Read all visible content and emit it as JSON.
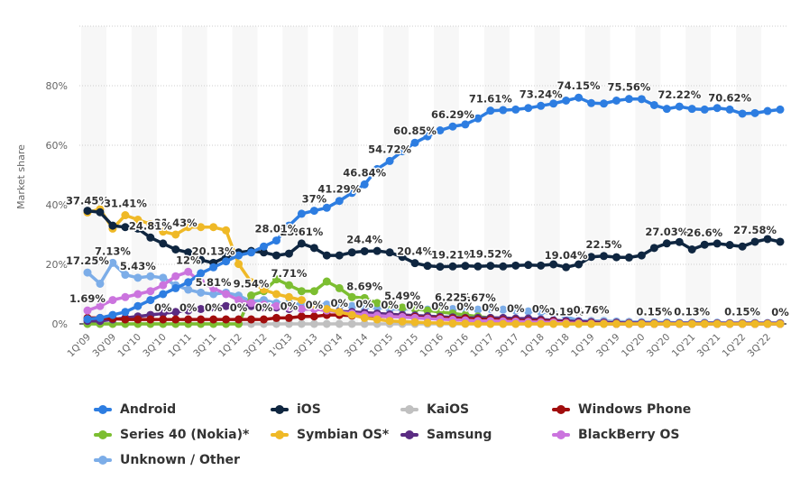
{
  "chart_data": {
    "type": "line",
    "title": "",
    "xlabel": "",
    "ylabel": "Market share",
    "ylim": [
      0,
      100
    ],
    "yticks": [
      "0%",
      "20%",
      "40%",
      "60%",
      "80%"
    ],
    "ytick_values": [
      0,
      20,
      40,
      60,
      80
    ],
    "grid": true,
    "legend_position": "bottom",
    "categories": [
      "1Q'09",
      "2Q'09",
      "3Q'09",
      "4Q'09",
      "1Q'10",
      "2Q'10",
      "3Q'10",
      "4Q'10",
      "1Q'11",
      "2Q'11",
      "3Q'11",
      "4Q'11",
      "1Q'12",
      "2Q'12",
      "3Q'12",
      "4Q'12",
      "1Q'13",
      "2Q'13",
      "3Q'13",
      "4Q'13",
      "1Q'14",
      "2Q'14",
      "3Q'14",
      "4Q'14",
      "1Q'15",
      "2Q'15",
      "3Q'15",
      "4Q'15",
      "1Q'16",
      "2Q'16",
      "3Q'16",
      "4Q'16",
      "1Q'17",
      "2Q'17",
      "3Q'17",
      "4Q'17",
      "1Q'18",
      "2Q'18",
      "3Q'18",
      "4Q'18",
      "1Q'19",
      "2Q'19",
      "3Q'19",
      "4Q'19",
      "1Q'20",
      "2Q'20",
      "3Q'20",
      "4Q'20",
      "1Q'21",
      "2Q'21",
      "3Q'21",
      "4Q'21",
      "1Q'22",
      "2Q'22",
      "3Q'22",
      "4Q'22"
    ],
    "xtick_labels": [
      "1Q'09",
      "3Q'09",
      "1Q'10",
      "3Q'10",
      "1Q'11",
      "3Q'11",
      "1Q'12",
      "3Q'12",
      "1'Q13",
      "3Q'13",
      "1Q'14",
      "3Q'14",
      "1Q'15",
      "3Q'15",
      "1Q'16",
      "3Q'16",
      "1Q'17",
      "3Q'17",
      "1Q'18",
      "3Q'18",
      "1Q'19",
      "3Q'19",
      "1Q'20",
      "3Q'20",
      "1Q'21",
      "3Q'21",
      "1Q'22",
      "3Q'22"
    ],
    "series": [
      {
        "name": "Unknown / Other",
        "color": "#7cade8",
        "values": [
          17.25,
          13.5,
          20.5,
          16.5,
          15.5,
          16,
          15.5,
          13,
          11.5,
          10.5,
          10,
          10.5,
          9.5,
          7.5,
          8,
          7,
          7,
          6.5,
          6.5,
          6.5,
          6,
          6,
          5.5,
          5.5,
          5,
          5,
          5,
          4.8,
          5.5,
          5,
          5,
          4.8,
          5,
          4.8,
          4.5,
          4.2,
          4,
          3.5,
          2.5,
          1,
          1,
          1,
          0.8,
          0.7,
          0.6,
          0.5,
          0.5,
          0.4,
          0.4,
          0.4,
          0.4,
          0.3,
          0.3,
          0.3,
          0.3,
          0.3
        ],
        "labels": {
          "0": "17.25%",
          "2": "7.13%",
          "4": "5.43%",
          "10": "5.81%",
          "29": "6.22%",
          "31": "5.67%"
        }
      },
      {
        "name": "KaiOS",
        "color": "#c0c0c0",
        "values": [
          0,
          0,
          0,
          0,
          0,
          0,
          0,
          0,
          0,
          0,
          0,
          0,
          0,
          0,
          0,
          0,
          0,
          0,
          0,
          0,
          0,
          0,
          0,
          0,
          0,
          0,
          0,
          0,
          0,
          0,
          0,
          0,
          0,
          0,
          0,
          0,
          0,
          0,
          0.19,
          0.5,
          0.76,
          0.6,
          0.5,
          0.4,
          0.15,
          0.15,
          0.15,
          0.13,
          0.13,
          0.13,
          0.15,
          0.15,
          0.15,
          0.1,
          0,
          0
        ],
        "labels": {
          "38": "0.19%",
          "40": "0.76%",
          "45": "0.15%",
          "48": "0.13%",
          "52": "0.15%",
          "55": "0%"
        }
      },
      {
        "name": "Series 40 (Nokia)*",
        "color": "#7cbe31",
        "values": [
          0,
          0,
          0,
          0,
          0,
          0,
          0,
          0,
          0,
          0,
          0,
          0,
          0,
          9.54,
          11,
          14.96,
          13,
          11,
          11,
          14.24,
          12,
          9,
          8.69,
          7,
          6.5,
          5.49,
          5,
          4.5,
          4,
          3.5,
          3,
          2.5,
          2,
          1.5,
          1,
          0.8,
          0.5,
          0.3,
          0,
          0,
          0,
          0,
          0,
          0,
          0,
          0,
          0,
          0,
          0,
          0,
          0,
          0,
          0,
          0,
          0,
          0
        ],
        "labels": {
          "13": "9.54%",
          "16": "7.71%",
          "22": "8.69%",
          "25": "5.49%"
        }
      },
      {
        "name": "Samsung",
        "color": "#5b2c83",
        "values": [
          1,
          1,
          1.5,
          2,
          2.5,
          3,
          3.5,
          4,
          4.5,
          5,
          5.5,
          6,
          6.5,
          6,
          5.5,
          5.5,
          5,
          5,
          5,
          4.5,
          4.2,
          4,
          3.8,
          3.5,
          3.2,
          3,
          2.8,
          2.6,
          2.4,
          2.2,
          2,
          2,
          2,
          2,
          1.8,
          1.8,
          1.5,
          1.2,
          1,
          0.8,
          0.6,
          0.5,
          0.4,
          0.3,
          0.3,
          0.2,
          0.2,
          0.2,
          0.2,
          0.2,
          0.2,
          0.2,
          0.2,
          0.2,
          0.2,
          0.2
        ],
        "labels": {}
      },
      {
        "name": "Windows Phone",
        "color": "#a10d0d",
        "values": [
          2,
          2,
          1.8,
          1.5,
          1.5,
          1.5,
          1.5,
          1.5,
          1.5,
          1.5,
          1.5,
          1.5,
          1.5,
          1.5,
          1.5,
          2,
          2,
          2.5,
          2.5,
          3,
          3,
          2.8,
          2.8,
          2.6,
          2.5,
          2.4,
          2.3,
          2,
          2,
          1.8,
          1.8,
          1.5,
          1.5,
          1.3,
          1.2,
          1,
          1,
          0.8,
          0.5,
          0.3,
          0.2,
          0.1,
          0,
          0,
          0,
          0,
          0,
          0,
          0,
          0,
          0,
          0,
          0,
          0,
          0,
          0
        ],
        "labels": {
          "6": "0%",
          "8": "0%",
          "10": "0%",
          "12": "0%",
          "14": "0%",
          "16": "0%",
          "18": "0%",
          "20": "0%",
          "22": "0%",
          "24": "0%",
          "26": "0%",
          "28": "0%",
          "30": "0%",
          "32": "0%",
          "34": "0%",
          "36": "0%"
        }
      },
      {
        "name": "BlackBerry OS",
        "color": "#cb74de",
        "values": [
          4.5,
          6,
          8,
          9,
          10,
          11,
          13,
          16,
          17.5,
          14,
          12,
          10,
          8,
          7,
          6.5,
          6,
          5.5,
          5,
          5,
          4.5,
          4,
          3.5,
          3,
          2.8,
          2.5,
          2.3,
          2,
          1.8,
          1.6,
          1.4,
          1.2,
          1,
          1,
          0.9,
          0.8,
          0.7,
          0.6,
          0.5,
          0.3,
          0.2,
          0.1,
          0.1,
          0,
          0,
          0,
          0,
          0,
          0,
          0,
          0,
          0,
          0,
          0,
          0,
          0,
          0
        ],
        "labels": {
          "0": "1.69%",
          "8": "12%"
        }
      },
      {
        "name": "Symbian OS*",
        "color": "#efb927",
        "values": [
          37.45,
          38.5,
          32,
          36.5,
          35,
          33.5,
          31,
          30,
          32.5,
          32.5,
          32.5,
          31.43,
          20.13,
          14,
          11.5,
          10,
          9,
          8,
          6.5,
          5,
          4,
          3,
          2,
          1.5,
          1,
          0.8,
          0.6,
          0.4,
          0.3,
          0.2,
          0.1,
          0,
          0,
          0,
          0,
          0,
          0,
          0,
          0,
          0,
          0,
          0,
          0,
          0,
          0,
          0,
          0,
          0,
          0,
          0,
          0,
          0,
          0,
          0,
          0,
          0
        ],
        "labels": {
          "0": "37.45%",
          "3": "31.41%",
          "7": "31.43%"
        }
      },
      {
        "name": "iOS",
        "color": "#0f2640",
        "values": [
          38,
          37.5,
          33,
          32.5,
          32,
          29,
          27,
          25,
          24,
          21.5,
          20.5,
          22.5,
          24,
          24.5,
          24,
          23,
          23.61,
          27,
          25.5,
          23,
          23,
          24,
          24.4,
          24.5,
          24,
          22.5,
          20.4,
          19.5,
          19.21,
          19.3,
          19.5,
          19.3,
          19.52,
          19.3,
          19.6,
          19.8,
          19.6,
          20,
          19.04,
          20,
          22.5,
          22.8,
          22.4,
          22.3,
          23,
          25.5,
          27.03,
          27.5,
          25,
          26.6,
          27,
          26.5,
          26,
          27.58,
          28.5,
          27.58
        ],
        "labels": {
          "5": "24.81%",
          "10": "20.13%",
          "17": "23.61%",
          "22": "24.4%",
          "26": "20.4%",
          "29": "19.21%",
          "32": "19.52%",
          "38": "19.04%",
          "41": "22.5%",
          "46": "27.03%",
          "49": "26.6%",
          "53": "27.58%"
        }
      },
      {
        "name": "Android",
        "color": "#2d7de1",
        "values": [
          1.6,
          2,
          3,
          4,
          6,
          8,
          10,
          12,
          14,
          17,
          19,
          21,
          23,
          24,
          26,
          28.01,
          33,
          37,
          38,
          39,
          41.29,
          44,
          46.84,
          52,
          54.72,
          58,
          60.85,
          63,
          65,
          66.29,
          67,
          69,
          71.61,
          71.8,
          72,
          72.5,
          73.24,
          74,
          75,
          76,
          74.15,
          74,
          75,
          75.56,
          75.5,
          73.5,
          72.22,
          73,
          72.22,
          72,
          72.5,
          72,
          70.62,
          70.8,
          71.5,
          72
        ],
        "labels": {
          "15": "28.01%",
          "18": "37%",
          "20": "41.29%",
          "22": "46.84%",
          "24": "54.72%",
          "26": "60.85%",
          "29": "66.29%",
          "32": "71.61%",
          "36": "73.24%",
          "39": "74.15%",
          "43": "75.56%",
          "47": "72.22%",
          "51": "70.62%"
        }
      }
    ],
    "legend": [
      {
        "name": "Android",
        "color": "#2d7de1"
      },
      {
        "name": "iOS",
        "color": "#0f2640"
      },
      {
        "name": "KaiOS",
        "color": "#c0c0c0"
      },
      {
        "name": "Windows Phone",
        "color": "#a10d0d"
      },
      {
        "name": "Series 40 (Nokia)*",
        "color": "#7cbe31"
      },
      {
        "name": "Symbian OS*",
        "color": "#efb927"
      },
      {
        "name": "Samsung",
        "color": "#5b2c83"
      },
      {
        "name": "BlackBerry OS",
        "color": "#cb74de"
      },
      {
        "name": "Unknown / Other",
        "color": "#7cade8"
      }
    ]
  }
}
